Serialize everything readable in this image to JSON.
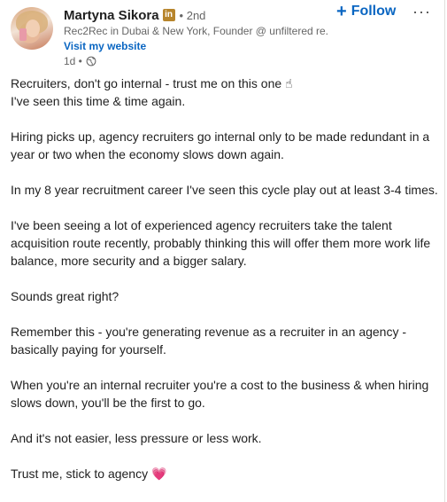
{
  "author": {
    "name": "Martyna Sikora",
    "badge": "in",
    "degree": "• 2nd",
    "headline": "Rec2Rec in Dubai & New York, Founder @ unfiltered re...",
    "website_label": "Visit my website",
    "time": "1d •",
    "visibility_icon": "globe-icon"
  },
  "actions": {
    "follow_icon": "+",
    "follow_label": "Follow",
    "more_label": "···"
  },
  "post": {
    "line1": "Recruiters, don't go internal - trust me on this one ☝",
    "line2": "I've seen this time & time again.",
    "p2": "Hiring picks up, agency recruiters go internal only to be made redundant in a year or two when the economy slows down again.",
    "p3": "In my 8 year recruitment career I've seen this cycle play out at least 3-4 times.",
    "p4": "I've been seeing a lot of experienced agency recruiters take the talent acquisition route recently, probably thinking this will offer them more work life balance, more security and a bigger salary.",
    "p5": "Sounds great right?",
    "p6": "Remember this - you're generating revenue as a recruiter in an agency - basically paying for yourself.",
    "p7": "When you're an internal recruiter you're a cost to the business & when hiring slows down, you'll be the first to go.",
    "p8": "And it's not easier, less pressure or less work.",
    "p9": "Trust me, stick to agency 💗"
  },
  "colors": {
    "accent": "#0a66c2",
    "text": "#1f1f1f",
    "muted": "#666666",
    "badge": "#b7852c"
  }
}
